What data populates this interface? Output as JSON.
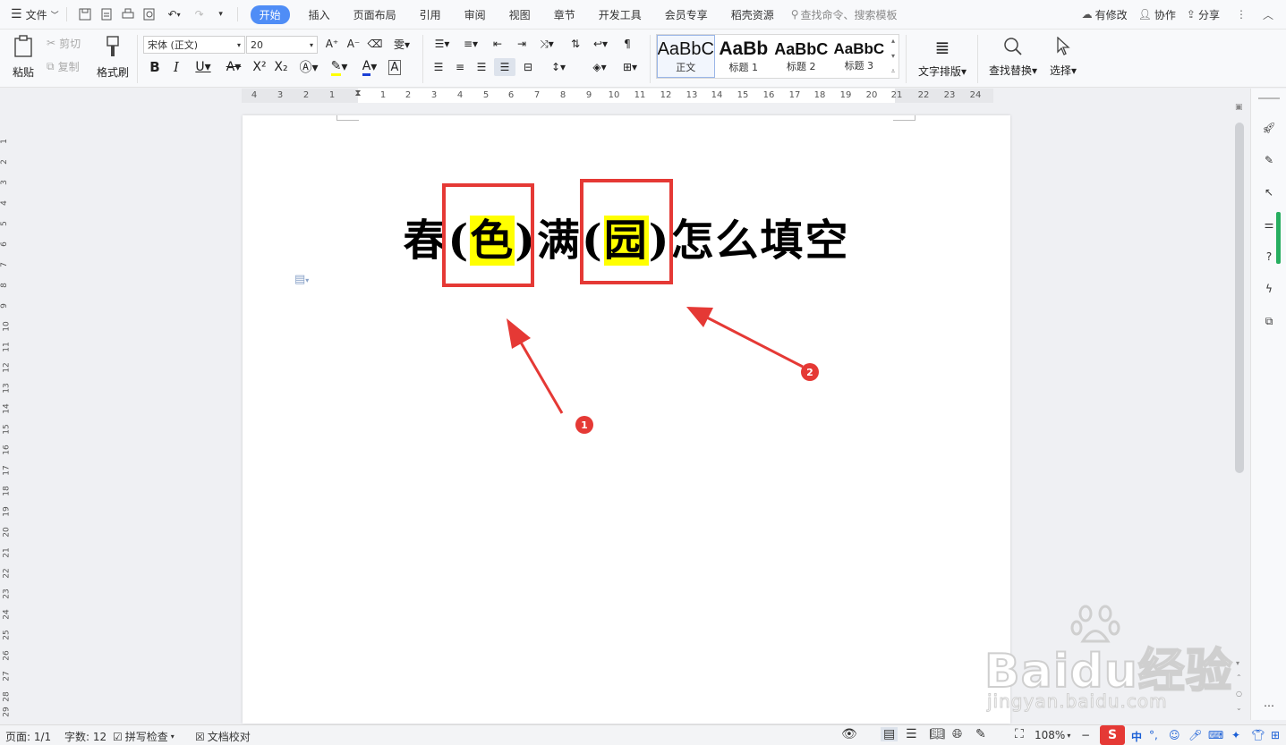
{
  "menubar": {
    "file_label": "文件",
    "tabs": [
      "开始",
      "插入",
      "页面布局",
      "引用",
      "审阅",
      "视图",
      "章节",
      "开发工具",
      "会员专享",
      "稻壳资源"
    ],
    "search_placeholder": "查找命令、搜索模板",
    "modified_label": "有修改",
    "collab_label": "协作",
    "share_label": "分享"
  },
  "ribbon": {
    "paste_label": "粘贴",
    "cut_label": "剪切",
    "copy_label": "复制",
    "format_painter_label": "格式刷",
    "font_name": "宋体 (正文)",
    "font_size": "20",
    "styles": [
      {
        "preview": "AaBbC",
        "label": "正文"
      },
      {
        "preview": "AaBb",
        "label": "标题 1"
      },
      {
        "preview": "AaBbC",
        "label": "标题 2"
      },
      {
        "preview": "AaBbC",
        "label": "标题 3"
      }
    ],
    "text_layout_label": "文字排版",
    "find_replace_label": "查找替换",
    "select_label": "选择"
  },
  "ruler": {
    "labels": [
      "4",
      "3",
      "2",
      "1",
      "",
      "1",
      "2",
      "3",
      "4",
      "5",
      "6",
      "7",
      "8",
      "9",
      "10",
      "11",
      "12",
      "13",
      "14",
      "15",
      "16",
      "17",
      "18",
      "19",
      "20",
      "21",
      "22",
      "23",
      "24"
    ]
  },
  "vruler": {
    "labels": [
      "1",
      "2",
      "3",
      "4",
      "5",
      "6",
      "7",
      "8",
      "9",
      "10",
      "11",
      "12",
      "13",
      "14",
      "15",
      "16",
      "17",
      "18",
      "19",
      "20",
      "21",
      "22",
      "23",
      "24",
      "25",
      "26",
      "27",
      "28",
      "29"
    ]
  },
  "document": {
    "title_parts": [
      "春(",
      "色",
      ")满(",
      "园",
      ")怎么填空"
    ],
    "annotation_1": "1",
    "annotation_2": "2"
  },
  "statusbar": {
    "page": "页面: 1/1",
    "word_count": "字数: 12",
    "spell_check": "拼写检查",
    "doc_proof": "文档校对",
    "zoom": "108%"
  },
  "watermark": {
    "brand": "Baidu经验",
    "url": "jingyan.baidu.com"
  },
  "colors": {
    "accent": "#4f8df6",
    "highlight": "#ffff00",
    "annotation": "#e53935"
  }
}
